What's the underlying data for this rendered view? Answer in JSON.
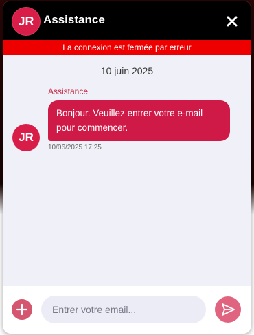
{
  "header": {
    "avatar_initials": "JR",
    "title": "Assistance",
    "close_icon": "close-icon"
  },
  "banner": {
    "text": "La connexion est fermée par erreur"
  },
  "messages": {
    "date": "10 juin 2025",
    "items": [
      {
        "sender": "Assistance",
        "avatar_initials": "JR",
        "text": "Bonjour. Veuillez entrer votre e-mail pour commencer.",
        "timestamp": "10/06/2025 17:25"
      }
    ]
  },
  "composer": {
    "add_icon": "plus-icon",
    "placeholder": "Entrer votre email...",
    "value": "",
    "send_icon": "send-icon"
  },
  "colors": {
    "accent": "#d81e48",
    "header_bg": "#000000",
    "error_banner": "#ee0000",
    "chat_bg": "#f0f0f8"
  }
}
